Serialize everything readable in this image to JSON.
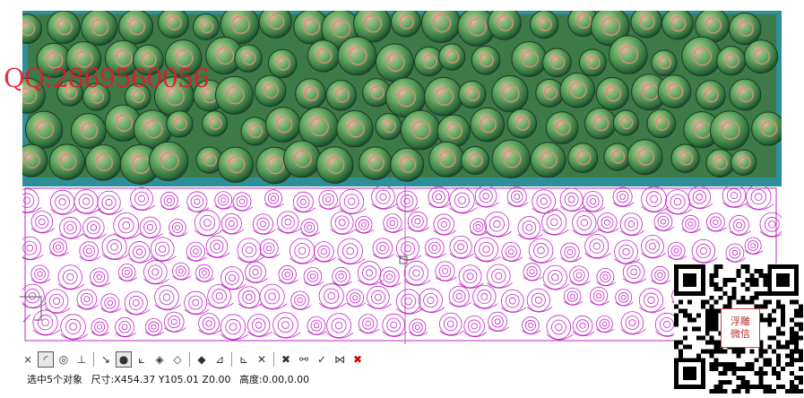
{
  "watermark": {
    "text": "QQ:2869560056"
  },
  "colors": {
    "frame_teal": "#2e8f98",
    "relief_green": "#4f9f58",
    "relief_shadow": "#1f4a30",
    "relief_highlight": "#e39a8c",
    "vector_line": "#c026c4",
    "watermark": "#e8182c"
  },
  "toolbar": {
    "tools": [
      {
        "name": "close-shape-tool-icon",
        "glyph": "⨯"
      },
      {
        "name": "arc-corner-tool-icon",
        "glyph": "◜"
      },
      {
        "name": "circle-snap-tool-icon",
        "glyph": "◎"
      },
      {
        "name": "perpendicular-tool-icon",
        "glyph": "⊥"
      },
      {
        "name": "tangent-tool-icon",
        "glyph": "↘"
      },
      {
        "name": "point-snap-tool-icon",
        "glyph": "●"
      },
      {
        "name": "node-edit-tool-icon",
        "glyph": "⟀"
      },
      {
        "name": "diamond-node-tool-icon",
        "glyph": "◈"
      },
      {
        "name": "diamond-outline-tool-icon",
        "glyph": "◇"
      },
      {
        "name": "diamond-split-tool-icon",
        "glyph": "◆"
      },
      {
        "name": "extend-tool-icon",
        "glyph": "⊿"
      },
      {
        "name": "trim-tool-icon",
        "glyph": "⊾"
      },
      {
        "name": "break-node-tool-icon",
        "glyph": "✕"
      },
      {
        "name": "join-node-tool-icon",
        "glyph": "✖"
      },
      {
        "name": "smooth-node-tool-icon",
        "glyph": "⚯"
      },
      {
        "name": "check-node-tool-icon",
        "glyph": "✓"
      },
      {
        "name": "filter-node-tool-icon",
        "glyph": "⋈"
      },
      {
        "name": "delete-tool-icon",
        "glyph": "✖"
      }
    ]
  },
  "status": {
    "selection": "选中5个对象",
    "size": "尺寸:X454.37 Y105.01 Z0.00",
    "height": "高度:0.00,0.00"
  },
  "qr": {
    "label_line1": "浮雕",
    "label_line2": "微信"
  }
}
